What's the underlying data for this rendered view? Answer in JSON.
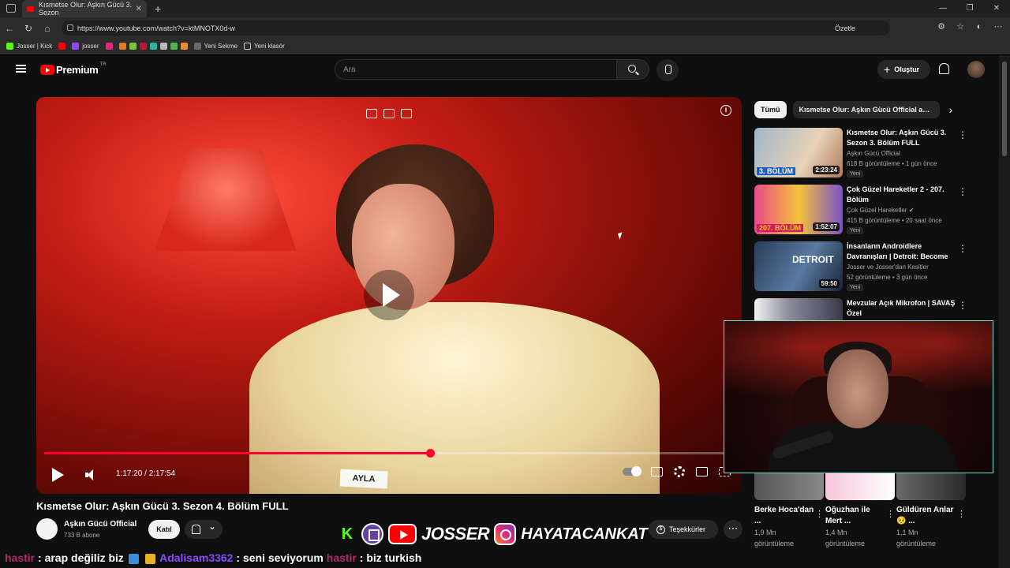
{
  "browser": {
    "tab_title": "Kısmetse Olur: Aşkın Gücü 3. Sezon",
    "url": "https://www.youtube.com/watch?v=ktMNOTX0d-w",
    "summarize_label": "Özetle",
    "bookmarks": [
      "Josser | Kick",
      "josser",
      "Yeni Sekme",
      "Yeni klasör"
    ]
  },
  "youtube": {
    "logo_word": "Premium",
    "region": "TR",
    "search_placeholder": "Ara",
    "create_label": "Oluştur"
  },
  "player": {
    "time": "1:17:20 / 2:17:54",
    "progress_fraction": 0.56,
    "name_badge": "AYLA"
  },
  "video": {
    "title": "Kısmetse Olur: Aşkın Gücü 3. Sezon 4. Bölüm FULL",
    "channel": "Aşkın Gücü Official",
    "subscribers": "733 B abone",
    "join_label": "Katıl",
    "thanks_label": "Teşekkürler"
  },
  "overlay": {
    "wordmark": "JOSSER",
    "handle": "HAYATACANKAT"
  },
  "ticker": {
    "user1": "hastir",
    "msg1": ": arap değiliz biz",
    "user2": "Adalisam3362",
    "msg2": ": seni seviyorum",
    "user3": "hastir",
    "msg3": ": biz turkish"
  },
  "sidebar": {
    "chips": [
      "Tümü",
      "Kısmetse Olur: Aşkın Gücü Official adlı yükleyiciden"
    ],
    "items": [
      {
        "title": "Kısmetse Olur: Aşkın Gücü 3. Sezon 3. Bölüm FULL",
        "channel": "Aşkın Gücü Official",
        "meta": "618 B görüntüleme • 1 gün önce",
        "badge": "Yeni",
        "duration": "2:23:24",
        "thumb_label": "3. BÖLÜM"
      },
      {
        "title": "Çok Güzel Hareketler 2 - 207. Bölüm",
        "channel": "Çok Güzel Hareketler",
        "meta": "415 B görüntüleme • 20 saat önce",
        "badge": "Yeni",
        "duration": "1:52:07",
        "thumb_label": "207. BÖLÜM"
      },
      {
        "title": "İnsanların Androidlere Davranışları | Detroit: Become ...",
        "channel": "Josser ve Josser'dan Kesitler",
        "meta": "52 görüntüleme • 3 gün önce",
        "badge": "Yeni",
        "duration": "59:50",
        "thumb_label": "DETROIT"
      },
      {
        "title": "Mevzular Açık Mikrofon | SAVAŞ Özel",
        "channel": "",
        "meta": "",
        "badge": "",
        "duration": "",
        "thumb_label": ""
      }
    ],
    "bottom": [
      {
        "title": "Berke Hoca'dan ...",
        "meta": "1,9 Mn görüntüleme"
      },
      {
        "title": "Oğuzhan ile Mert ...",
        "meta": "1,4 Mn görüntüleme"
      },
      {
        "title": "Güldüren Anlar🥺 ...",
        "meta": "1,1 Mn görüntüleme"
      }
    ]
  },
  "colors": {
    "accent": "#ff0033",
    "background": "#0f0f0f"
  }
}
